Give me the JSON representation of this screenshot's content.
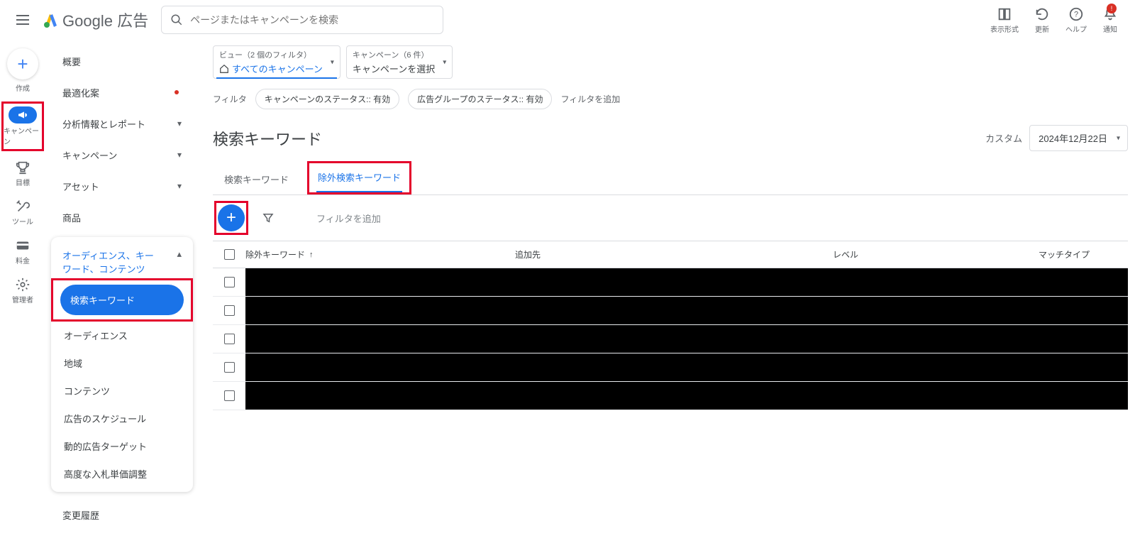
{
  "header": {
    "logo_product": "Google",
    "logo_suffix": "広告",
    "search_placeholder": "ページまたはキャンペーンを検索",
    "actions": {
      "appearance": "表示形式",
      "refresh": "更新",
      "help": "ヘルプ",
      "notifications": "通知",
      "notif_badge": "!"
    }
  },
  "rail": {
    "create": "作成",
    "campaign": "キャンペーン",
    "goals": "目標",
    "tools": "ツール",
    "billing": "料金",
    "admin": "管理者"
  },
  "sidebar": {
    "items": {
      "overview": "概要",
      "optimization": "最適化案",
      "insights": "分析情報とレポート",
      "campaign": "キャンペーン",
      "asset": "アセット",
      "products": "商品",
      "audience_section": "オーディエンス、キーワード、コンテンツ",
      "search_keywords": "検索キーワード",
      "audience": "オーディエンス",
      "geo": "地域",
      "content": "コンテンツ",
      "ad_schedule": "広告のスケジュール",
      "dynamic_target": "動的広告ターゲット",
      "bid_adj": "高度な入札単価調整",
      "change_history": "変更履歴"
    }
  },
  "top_controls": {
    "view": {
      "line1": "ビュー（2 個のフィルタ）",
      "line2": "すべてのキャンペーン"
    },
    "campaign": {
      "line1": "キャンペーン（6 件）",
      "line2": "キャンペーンを選択"
    }
  },
  "filters": {
    "label": "フィルタ",
    "chip1": "キャンペーンのステータス:: 有効",
    "chip2": "広告グループのステータス:: 有効",
    "add": "フィルタを追加"
  },
  "page_title": "検索キーワード",
  "date": {
    "label": "カスタム",
    "value": "2024年12月22日"
  },
  "tabs": {
    "search_kw": "検索キーワード",
    "neg_kw": "除外検索キーワード"
  },
  "toolbar": {
    "add_filter": "フィルタを追加"
  },
  "table": {
    "headers": {
      "kw": "除外キーワード",
      "added": "追加先",
      "level": "レベル",
      "match": "マッチタイプ"
    },
    "row_count": 5
  }
}
